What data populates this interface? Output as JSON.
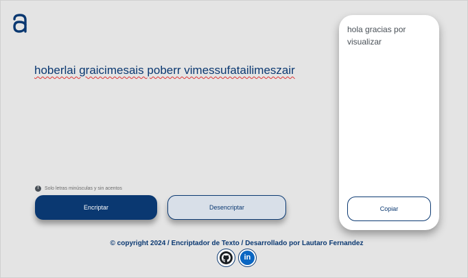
{
  "header": {
    "logo_icon": "alura-logo-icon"
  },
  "input": {
    "value": "hoberlai graicimesais poberr vimessufatailimeszair",
    "placeholder": ""
  },
  "hint": {
    "icon": "info-icon",
    "text": "Solo letras minúsculas y sin acentos"
  },
  "buttons": {
    "encrypt": "Encriptar",
    "decrypt": "Desencriptar",
    "copy": "Copiar"
  },
  "output": {
    "text": "hola gracias por visualizar"
  },
  "footer": {
    "text": "© copyright 2024 / Encriptador de Texto / Desarrollado por Lautaro Fernandez",
    "github_icon": "github-icon",
    "linkedin_icon": "linkedin-icon",
    "linkedin_glyph": "in"
  },
  "colors": {
    "background": "#e4e4e4",
    "primary": "#0a3871",
    "secondary": "#d8dfe8",
    "card": "#ffffff"
  }
}
